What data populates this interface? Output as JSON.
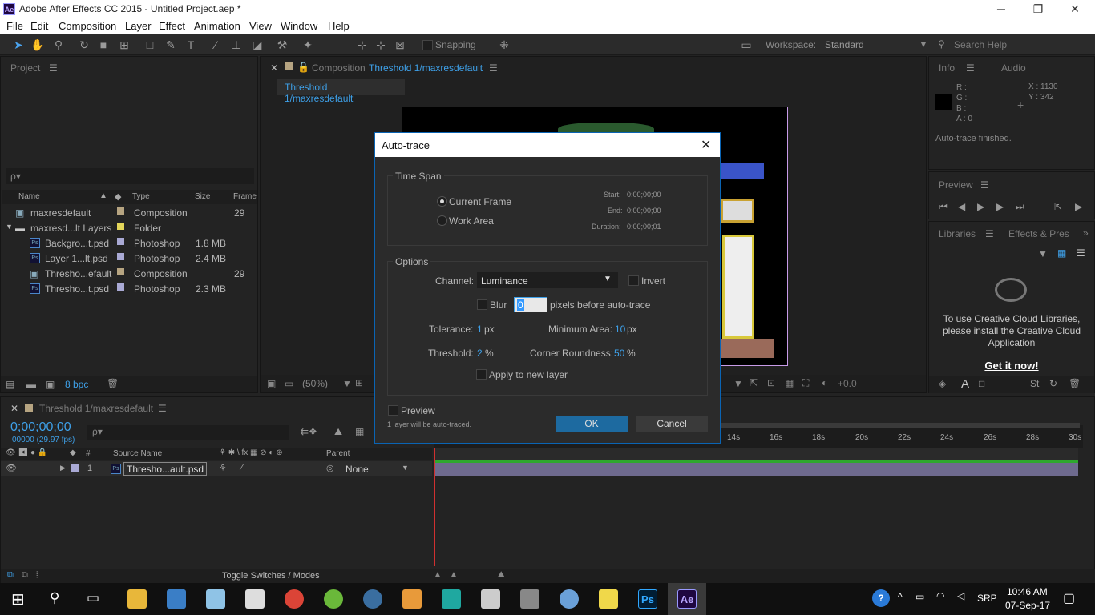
{
  "window": {
    "title": "Adobe After Effects CC 2015 - Untitled Project.aep *",
    "logo": "Ae"
  },
  "menu": [
    "File",
    "Edit",
    "Composition",
    "Layer",
    "Effect",
    "Animation",
    "View",
    "Window",
    "Help"
  ],
  "toolbar": {
    "snapping": "Snapping",
    "workspace_label": "Workspace:",
    "workspace_value": "Standard",
    "search_placeholder": "Search Help"
  },
  "project": {
    "tab": "Project",
    "search_placeholder": "ρ▾",
    "columns": [
      "Name",
      "Type",
      "Size",
      "Frame"
    ],
    "rows": [
      {
        "name": "maxresdefault",
        "type": "Composition",
        "size": "",
        "frame": "29",
        "color": "#b6a481",
        "indent": 0,
        "icon": "comp"
      },
      {
        "name": "maxresd...lt Layers",
        "type": "Folder",
        "size": "",
        "frame": "",
        "color": "#e3d65a",
        "indent": 0,
        "icon": "folder"
      },
      {
        "name": "Backgro...t.psd",
        "type": "Photoshop",
        "size": "1.8 MB",
        "frame": "",
        "color": "#a9a9d4",
        "indent": 1,
        "icon": "psd"
      },
      {
        "name": "Layer 1...lt.psd",
        "type": "Photoshop",
        "size": "2.4 MB",
        "frame": "",
        "color": "#a9a9d4",
        "indent": 1,
        "icon": "psd"
      },
      {
        "name": "Thresho...efault",
        "type": "Composition",
        "size": "",
        "frame": "29",
        "color": "#b6a481",
        "indent": 1,
        "icon": "comp"
      },
      {
        "name": "Thresho...t.psd",
        "type": "Photoshop",
        "size": "2.3 MB",
        "frame": "",
        "color": "#a9a9d4",
        "indent": 1,
        "icon": "psd"
      }
    ],
    "bpc": "8 bpc"
  },
  "composition": {
    "tab_prefix": "Composition",
    "tab_name": "Threshold 1/maxresdefault",
    "subtab": "Threshold 1/maxresdefault",
    "zoom": "(50%)",
    "exposure": "+0.0"
  },
  "info": {
    "tab": "Info",
    "tab2": "Audio",
    "r": "R :",
    "g": "G :",
    "b": "B :",
    "a": "A : 0",
    "x": "X : 1130",
    "y": "Y : 342",
    "status": "Auto-trace finished."
  },
  "preview": {
    "tab": "Preview"
  },
  "libraries": {
    "tab": "Libraries",
    "tab2": "Effects & Pres",
    "message": "To use Creative Cloud Libraries, please install the Creative Cloud Application",
    "link": "Get it now!"
  },
  "timeline": {
    "tab": "Threshold 1/maxresdefault",
    "timecode": "0;00;00;00",
    "fps": "00000 (29.97 fps)",
    "col_source": "Source Name",
    "col_parent": "Parent",
    "layer_num": "1",
    "layer_name": "Thresho...ault.psd",
    "layer_parent": "None",
    "ruler": [
      "14s",
      "16s",
      "18s",
      "20s",
      "22s",
      "24s",
      "26s",
      "28s",
      "30s"
    ],
    "toggle": "Toggle Switches / Modes"
  },
  "dialog": {
    "title": "Auto-trace",
    "timespan": "Time Span",
    "current_frame": "Current Frame",
    "work_area": "Work Area",
    "start_label": "Start:",
    "start_val": "0:00;00;00",
    "end_label": "End:",
    "end_val": "0:00;00;00",
    "duration_label": "Duration:",
    "duration_val": "0:00;00;01",
    "options": "Options",
    "channel_label": "Channel:",
    "channel_val": "Luminance",
    "invert": "Invert",
    "blur": "Blur",
    "blur_val": "0",
    "blur_suffix": "pixels before auto-trace",
    "tolerance_label": "Tolerance:",
    "tolerance_val": "1",
    "tolerance_unit": "px",
    "minarea_label": "Minimum Area:",
    "minarea_val": "10",
    "minarea_unit": "px",
    "threshold_label": "Threshold:",
    "threshold_val": "2",
    "threshold_unit": "%",
    "corner_label": "Corner Roundness:",
    "corner_val": "50",
    "corner_unit": "%",
    "apply_new": "Apply to new layer",
    "preview": "Preview",
    "note": "1 layer will be auto-traced.",
    "ok": "OK",
    "cancel": "Cancel"
  },
  "taskbar": {
    "lang": "SRP",
    "time": "10:46 AM",
    "date": "07-Sep-17",
    "ps": "Ps",
    "ae": "Ae"
  }
}
